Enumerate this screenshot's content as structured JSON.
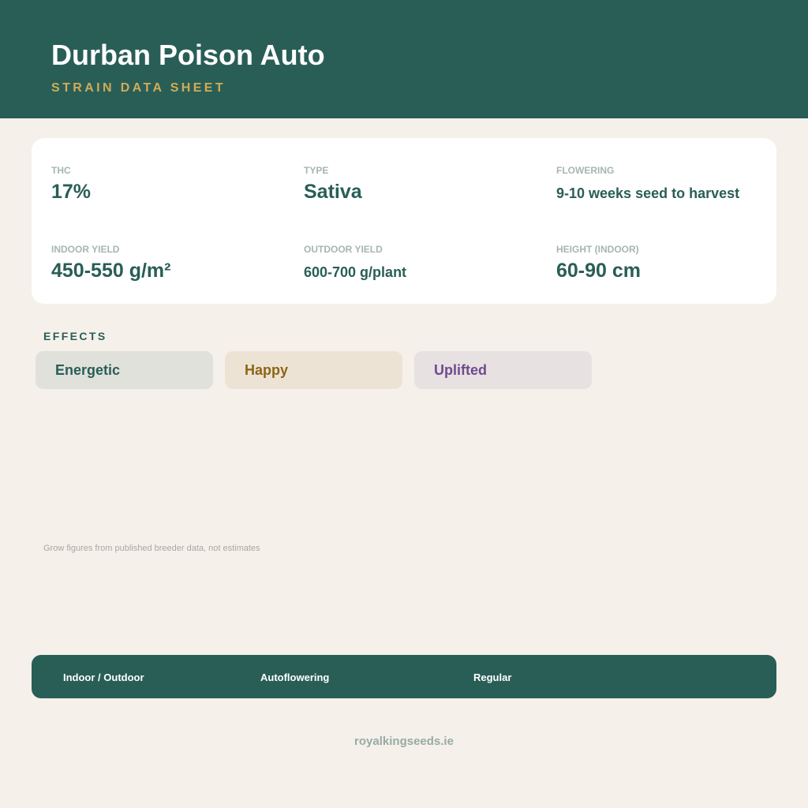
{
  "header": {
    "title": "Durban Poison Auto",
    "subtitle": "STRAIN DATA SHEET"
  },
  "stats": [
    {
      "label": "THC",
      "value": "17%"
    },
    {
      "label": "TYPE",
      "value": "Sativa"
    },
    {
      "label": "FLOWERING",
      "value": "9-10 weeks seed to harvest"
    },
    {
      "label": "INDOOR YIELD",
      "value": "450-550 g/m²"
    },
    {
      "label": "OUTDOOR YIELD",
      "value": "600-700 g/plant"
    },
    {
      "label": "HEIGHT (INDOOR)",
      "value": "60-90 cm"
    }
  ],
  "effects": {
    "heading": "EFFECTS",
    "items": [
      {
        "label": "Energetic",
        "color": "#295e57",
        "bg": "#e0e1db"
      },
      {
        "label": "Happy",
        "color": "#8c6516",
        "bg": "#ede3d5"
      },
      {
        "label": "Uplifted",
        "color": "#6f4a8f",
        "bg": "#e7e1e1"
      }
    ]
  },
  "note": "Grow figures from published breeder data, not estimates",
  "footer": {
    "items": [
      "Indoor / Outdoor",
      "Autoflowering",
      "Regular"
    ]
  },
  "site": "royalkingseeds.ie",
  "colors": {
    "brand_green": "#295e57",
    "accent_gold": "#d2ab57",
    "background": "#f5f0ea"
  }
}
